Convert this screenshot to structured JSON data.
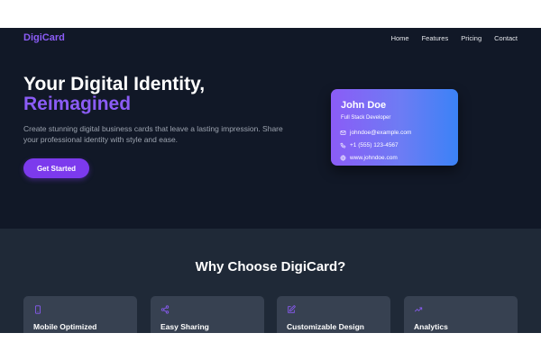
{
  "brand": {
    "name": "DigiCard",
    "accent": "#8b5cf6",
    "button": "#7c3aed"
  },
  "nav": {
    "links": [
      "Home",
      "Features",
      "Pricing",
      "Contact"
    ]
  },
  "hero": {
    "title_line1": "Your Digital Identity,",
    "title_line2": "Reimagined",
    "description": "Create stunning digital business cards that leave a lasting impression. Share your professional identity with style and ease.",
    "cta_label": "Get Started"
  },
  "card": {
    "name": "John Doe",
    "role": "Full Stack Developer",
    "email": "johndoe@example.com",
    "phone": "+1 (555) 123-4567",
    "website": "www.johndoe.com",
    "icons": [
      "mail-icon",
      "phone-icon",
      "globe-icon"
    ]
  },
  "features": {
    "title": "Why Choose DigiCard?",
    "items": [
      {
        "label": "Mobile Optimized",
        "icon": "smartphone-icon"
      },
      {
        "label": "Easy Sharing",
        "icon": "share-icon"
      },
      {
        "label": "Customizable Design",
        "icon": "edit-icon"
      },
      {
        "label": "Analytics",
        "icon": "trending-up-icon"
      }
    ]
  }
}
